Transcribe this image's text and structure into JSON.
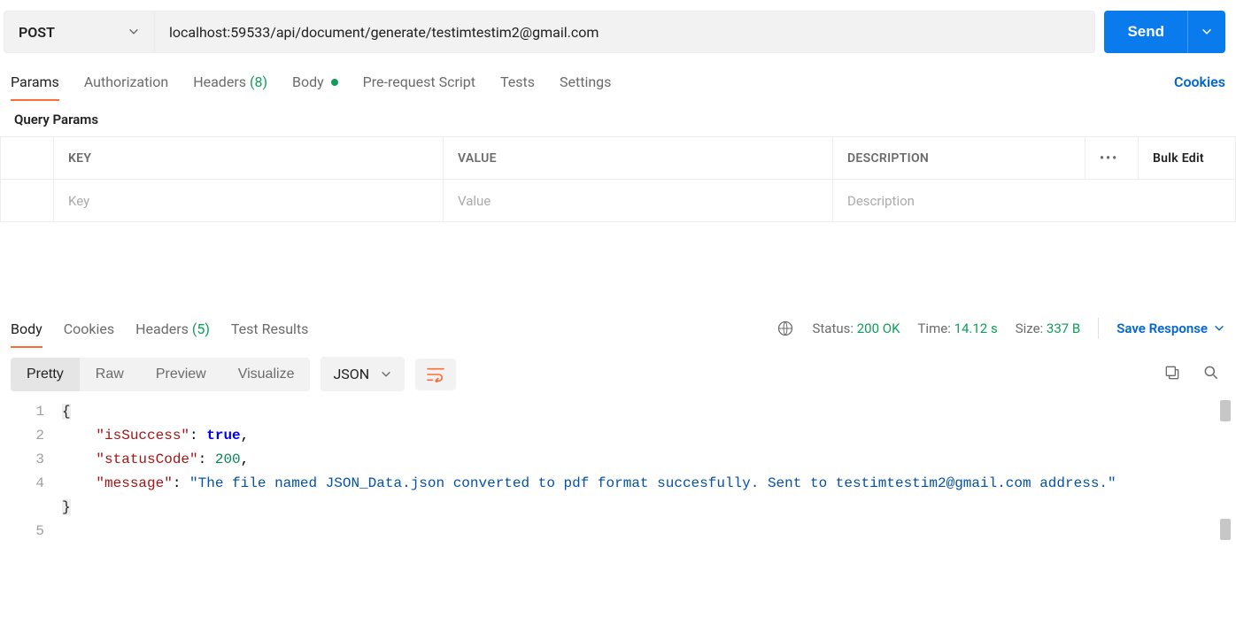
{
  "request": {
    "method": "POST",
    "url": "localhost:59533/api/document/generate/testimtestim2@gmail.com",
    "send_label": "Send"
  },
  "tabs": {
    "params": "Params",
    "auth": "Authorization",
    "headers": "Headers",
    "headers_count": "(8)",
    "body": "Body",
    "prerequest": "Pre-request Script",
    "tests": "Tests",
    "settings": "Settings",
    "cookies": "Cookies"
  },
  "query": {
    "title": "Query Params",
    "key_header": "KEY",
    "value_header": "VALUE",
    "desc_header": "DESCRIPTION",
    "bulk_edit": "Bulk Edit",
    "key_ph": "Key",
    "value_ph": "Value",
    "desc_ph": "Description"
  },
  "resp_tabs": {
    "body": "Body",
    "cookies": "Cookies",
    "headers": "Headers",
    "headers_count": "(5)",
    "test_results": "Test Results"
  },
  "resp_meta": {
    "status_label": "Status:",
    "status_value": "200 OK",
    "time_label": "Time:",
    "time_value": "14.12 s",
    "size_label": "Size:",
    "size_value": "337 B",
    "save_response": "Save Response"
  },
  "format_bar": {
    "pretty": "Pretty",
    "raw": "Raw",
    "preview": "Preview",
    "visualize": "Visualize",
    "json": "JSON"
  },
  "code": {
    "line1_open": "{",
    "line2_key": "\"isSuccess\"",
    "line2_val": "true",
    "line3_key": "\"statusCode\"",
    "line3_val": "200",
    "line4_key": "\"message\"",
    "line4_val": "\"The file named JSON_Data.json converted to pdf format succesfully. Sent to testimtestim2@gmail.com address.\"",
    "line5_close": "}",
    "ln1": "1",
    "ln2": "2",
    "ln3": "3",
    "ln4": "4",
    "ln5": "5"
  }
}
